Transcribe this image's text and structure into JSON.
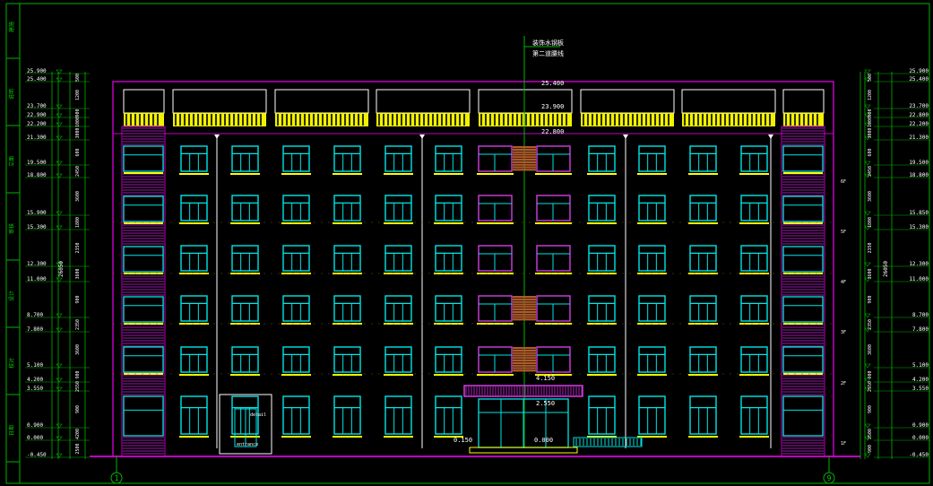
{
  "title_block": {
    "left_strip": [
      "建施",
      "说明",
      "立面",
      "审核",
      "设计",
      "校对",
      "日期"
    ]
  },
  "annotation": {
    "top_label_1": "装饰水钢板",
    "top_label_2": "第二道腰线",
    "roof_elev": "25.400",
    "parapet_elev": "23.900",
    "cornice_elev": "22.800",
    "entrance_elev_1": "4.150",
    "entrance_elev_2": "2.550",
    "entrance_floor": "0.000",
    "side_step": "0.150",
    "small_door_label": "detail",
    "small_base_label": "entrance"
  },
  "elevations_left": [
    "25.900",
    "25.400",
    "23.700",
    "22.900",
    "22.200",
    "21.300",
    "19.500",
    "18.800",
    "15.900",
    "15.300",
    "12.300",
    "11.000",
    "8.700",
    "7.800",
    "5.100",
    "4.200",
    "3.550",
    "0.900",
    "0.000",
    "-0.450"
  ],
  "elevations_right": [
    "25.900",
    "25.400",
    "23.700",
    "22.800",
    "22.200",
    "21.300",
    "19.500",
    "18.800",
    "15.850",
    "15.300",
    "12.300",
    "11.000",
    "8.700",
    "7.800",
    "5.100",
    "4.200",
    "3.550",
    "0.900",
    "0.000",
    "-0.450"
  ],
  "dims_left": [
    "500",
    "1200",
    "900",
    "1000",
    "3000",
    "600",
    "2450",
    "3600",
    "1800",
    "2350",
    "3600",
    "900",
    "2350",
    "3600",
    "900",
    "2550",
    "900",
    "4200",
    "2500",
    "900"
  ],
  "dims_right": [
    "500",
    "1200",
    "900",
    "1000",
    "3000",
    "600",
    "2450",
    "3600",
    "1800",
    "2350",
    "3600",
    "900",
    "2350",
    "3600",
    "900",
    "2550",
    "900",
    "2500",
    "900"
  ],
  "total_dim": "26050",
  "floor_labels": [
    "6F",
    "5F",
    "4F",
    "3F",
    "2F",
    "1F"
  ],
  "axis_left": "1",
  "axis_right": "9",
  "base_left": "-0.450",
  "base_right": "-0.450",
  "colors": {
    "background": "#000000",
    "outline": "#c000c0",
    "window": "#00e5e5",
    "parapet": "#ffff00",
    "dim": "#00c000",
    "text": "#ffffff",
    "brick": "#b05a2a"
  }
}
